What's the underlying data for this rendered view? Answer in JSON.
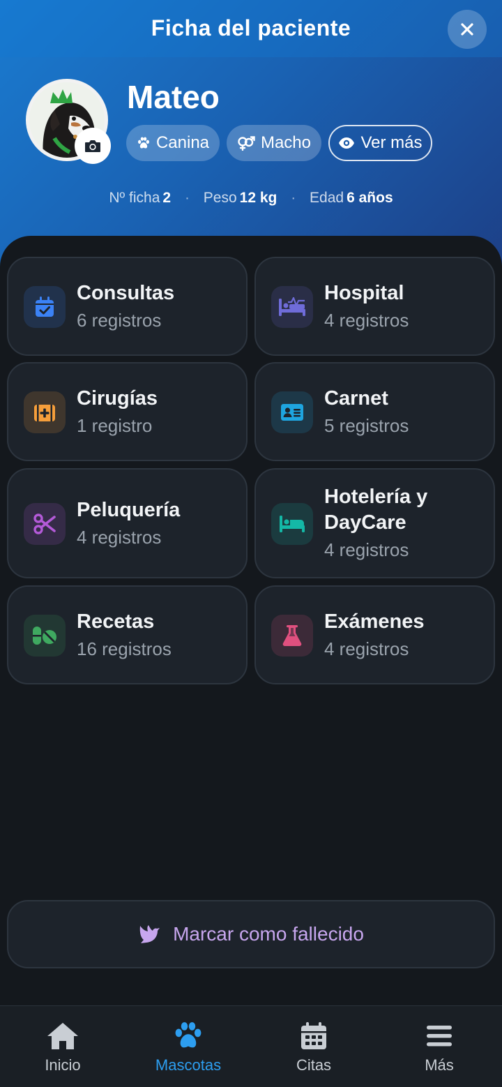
{
  "header": {
    "title": "Ficha del paciente",
    "close_icon": "close-icon"
  },
  "patient": {
    "name": "Mateo",
    "chips": [
      {
        "label": "Canina",
        "icon": "paw-icon"
      },
      {
        "label": "Macho",
        "icon": "male-female-icon"
      },
      {
        "label": "Ver más",
        "icon": "eye-icon"
      }
    ],
    "stats": [
      {
        "label": "Nº ficha",
        "value": "2"
      },
      {
        "label": "Peso",
        "value": "12 kg"
      },
      {
        "label": "Edad",
        "value": "6 años"
      }
    ]
  },
  "sections": [
    {
      "title": "Consultas",
      "count": "6 registros",
      "icon": "calendar-check-icon",
      "color": "#3b82f6"
    },
    {
      "title": "Hospital",
      "count": "4 registros",
      "icon": "hospital-bed-icon",
      "color": "#6f6cd9"
    },
    {
      "title": "Cirugías",
      "count": "1 registro",
      "icon": "surgery-kit-icon",
      "color": "#f59e3b"
    },
    {
      "title": "Carnet",
      "count": "5 registros",
      "icon": "id-card-icon",
      "color": "#1ea5e0"
    },
    {
      "title": "Peluquería",
      "count": "4 registros",
      "icon": "scissors-icon",
      "color": "#b45ad8"
    },
    {
      "title": "Hotelería y DayCare",
      "count": "4 registros",
      "icon": "bed-icon",
      "color": "#14b8a6"
    },
    {
      "title": "Recetas",
      "count": "16 registros",
      "icon": "pills-icon",
      "color": "#3fa960"
    },
    {
      "title": "Exámenes",
      "count": "4 registros",
      "icon": "flask-icon",
      "color": "#e0507f"
    }
  ],
  "actions": {
    "deceased_label": "Marcar como fallecido",
    "deceased_icon": "dove-icon"
  },
  "nav": [
    {
      "label": "Inicio",
      "icon": "home-icon"
    },
    {
      "label": "Mascotas",
      "icon": "paw-icon",
      "active": true
    },
    {
      "label": "Citas",
      "icon": "calendar-icon"
    },
    {
      "label": "Más",
      "icon": "menu-icon"
    }
  ],
  "colors": {
    "accent": "#2d9ef0",
    "header_start": "#1a7bd0",
    "header_end": "#1d3f86",
    "background": "#14181d",
    "card": "#1d232b",
    "deceased_text": "#c7a6ee"
  }
}
